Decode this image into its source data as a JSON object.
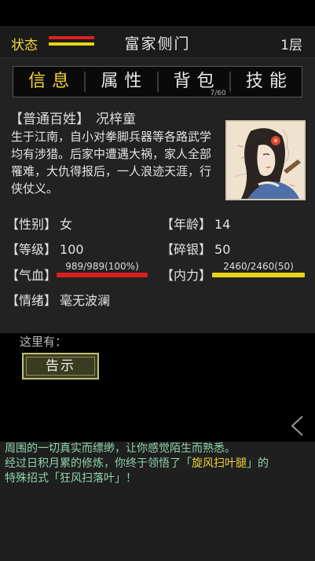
{
  "header": {
    "status_label": "状态",
    "location": "富家侧门",
    "floor": "1层"
  },
  "tabs": [
    {
      "label": "信息",
      "active": true
    },
    {
      "label": "属性"
    },
    {
      "label": "背包",
      "count": "7/60"
    },
    {
      "label": "技能"
    }
  ],
  "character": {
    "title": "【普通百姓】",
    "name": "况梓童",
    "bio": "生于江南，自小对拳脚兵器等各路武学均有涉猎。后家中遭遇大祸，家人全部罹难，大仇得报后，一人浪迹天涯，行侠仗义。",
    "stats": {
      "gender_label": "【性别】",
      "gender": "女",
      "age_label": "【年龄】",
      "age": "14",
      "level_label": "【等级】",
      "level": "100",
      "silver_label": "【碎银】",
      "silver": "50",
      "hp_label": "【气血】",
      "hp_text": "989/989(100%)",
      "hp_fill": 1.0,
      "mp_label": "【内力】",
      "mp_text": "2460/2460(50)",
      "mp_fill": 1.0,
      "mood_label": "【情绪】",
      "mood": "毫无波澜"
    }
  },
  "location_panel": {
    "here_label": "这里有：",
    "notice_button": "告示"
  },
  "log": {
    "line1": "周围的一切真实而缥缈，让你感觉陌生而熟悉。",
    "line2_pre": "经过日积月累的修炼，你终于领悟了「",
    "line2_skill": "旋风扫叶腿",
    "line2_post": "」的",
    "line3": "特殊招式「狂风扫落叶」！"
  },
  "colors": {
    "accent": "#f3d53a",
    "hp": "#d81e1e",
    "mp": "#e8d315",
    "log_text": "#8fd3ad"
  },
  "icons": {
    "back": "triangle-left-icon",
    "portrait": "character-portrait"
  }
}
